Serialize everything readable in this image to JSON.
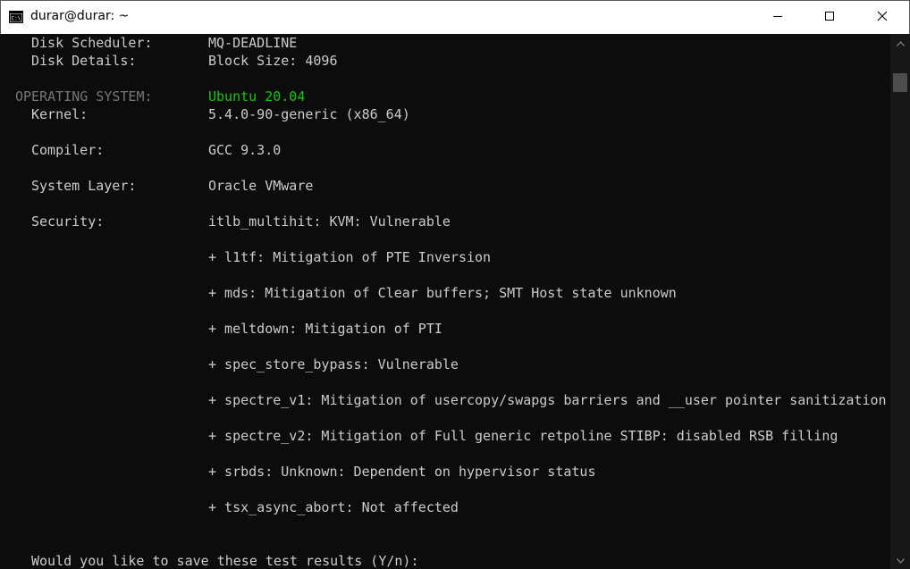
{
  "window": {
    "title": "durar@durar: ~",
    "icon": "console-icon",
    "controls": [
      "minimize-icon",
      "maximize-icon",
      "close-icon"
    ]
  },
  "terminal": {
    "colors": {
      "background": "#0c0c0c",
      "text": "#cccccc",
      "section_label": "#767676",
      "highlight": "#16c60c"
    },
    "lines": [
      {
        "label": "Disk Scheduler:",
        "value": "MQ-DEADLINE"
      },
      {
        "label": "Disk Details:",
        "value": "Block Size: 4096"
      },
      {
        "section": "OPERATING SYSTEM:",
        "value": "Ubuntu 20.04"
      },
      {
        "label": "Kernel:",
        "value": "5.4.0-90-generic (x86_64)"
      },
      {
        "label": "Compiler:",
        "value": "GCC 9.3.0"
      },
      {
        "label": "System Layer:",
        "value": "Oracle VMware"
      },
      {
        "label": "Security:",
        "value": "itlb_multihit: KVM: Vulnerable"
      },
      {
        "value": "+ l1tf: Mitigation of PTE Inversion"
      },
      {
        "value": "+ mds: Mitigation of Clear buffers; SMT Host state unknown"
      },
      {
        "value": "+ meltdown: Mitigation of PTI"
      },
      {
        "value": "+ spec_store_bypass: Vulnerable"
      },
      {
        "value": "+ spectre_v1: Mitigation of usercopy/swapgs barriers and __user pointer sanitization"
      },
      {
        "value": "+ spectre_v2: Mitigation of Full generic retpoline STIBP: disabled RSB filling"
      },
      {
        "value": "+ srbds: Unknown: Dependent on hypervisor status"
      },
      {
        "value": "+ tsx_async_abort: Not affected"
      }
    ],
    "prompt": "Would you like to save these test results (Y/n):"
  },
  "scrollbar": {
    "up_icon": "scroll-up-arrow-icon",
    "down_icon": "scroll-down-arrow-icon"
  }
}
